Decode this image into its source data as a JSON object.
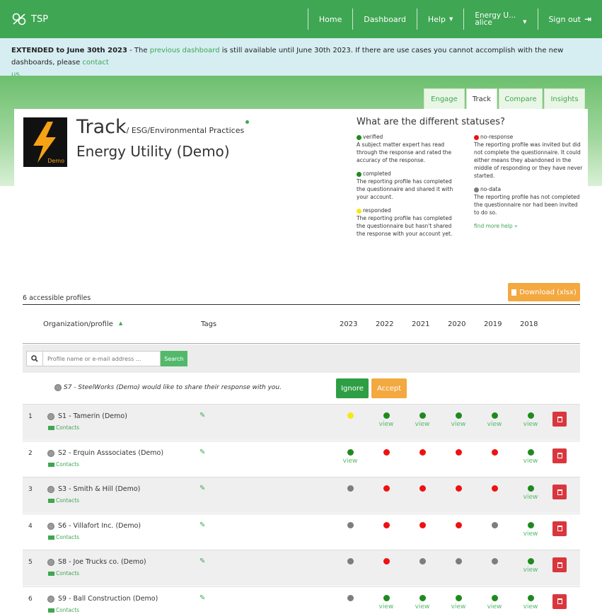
{
  "nav": {
    "brand": "TSP",
    "home": "Home",
    "dashboard": "Dashboard",
    "help": "Help",
    "account_line1": "Energy U...",
    "account_line2": "alice",
    "signout": "Sign out"
  },
  "alert": {
    "bold": "EXTENDED to June 30th 2023",
    "text1": " - The ",
    "link1": "previous dashboard",
    "text2": " is still available until June 30th 2023. If there are use cases you cannot accomplish with the new dashboards, please ",
    "link2": "contact",
    "link2b": "us",
    "text3": "."
  },
  "tabs": [
    "Engage",
    "Track",
    "Compare",
    "Insights"
  ],
  "active_tab": "Track",
  "header": {
    "logo_badge": "Demo",
    "title": "Track",
    "subtitle": "/ ESG/Environmental Practices",
    "org_name": "Energy Utility (Demo)"
  },
  "statuses": {
    "title": "What are the different statuses?",
    "items": [
      {
        "label": "verified",
        "color": "#1e8a1e",
        "description": "A subject matter expert has read through the response and rated the accuracy of the response."
      },
      {
        "label": "completed",
        "color": "#1e8a1e",
        "description": "The reporting profile has completed the questionnaire and shared it with your account."
      },
      {
        "label": "responded",
        "color": "#f7e815",
        "description": "The reporting profile has completed the questionnaire but hasn't shared the response with your account yet."
      },
      {
        "label": "no-response",
        "color": "#ee1111",
        "description": "The reporting profile was invited but did not complete the questionnaire. It could either means they abandoned in the middle of responding or they have never started."
      },
      {
        "label": "no-data",
        "color": "#7d7d7d",
        "description": "The reporting profile has not completed the questionnaire nor had been invited to do so."
      }
    ],
    "find_help": "find more help »"
  },
  "table": {
    "count_label": "6 accessible profiles",
    "download_label": "Download (xlsx)",
    "col_org": "Organization/profile",
    "col_tags": "Tags",
    "years": [
      "2023",
      "2022",
      "2021",
      "2020",
      "2019",
      "2018"
    ],
    "search_placeholder": "Profile name or e-mail address ...",
    "search_button": "Search",
    "share_request": "S7 - SteelWorks (Demo) would like to share their response with you.",
    "ignore_label": "Ignore",
    "accept_label": "Accept",
    "contacts_label": "Contacts",
    "view_label": "view",
    "rows": [
      {
        "num": "1",
        "name": "S1 - Tamerin (Demo)",
        "statuses": [
          "yellow",
          "green",
          "green",
          "green",
          "green",
          "green"
        ],
        "views": [
          false,
          true,
          true,
          true,
          true,
          true
        ]
      },
      {
        "num": "2",
        "name": "S2 - Erquin Asssociates (Demo)",
        "statuses": [
          "green",
          "red",
          "red",
          "red",
          "red",
          "green"
        ],
        "views": [
          true,
          false,
          false,
          false,
          false,
          true
        ]
      },
      {
        "num": "3",
        "name": "S3 - Smith & Hill (Demo)",
        "statuses": [
          "grey",
          "red",
          "red",
          "red",
          "red",
          "green"
        ],
        "views": [
          false,
          false,
          false,
          false,
          false,
          true
        ]
      },
      {
        "num": "4",
        "name": "S6 - Villafort Inc. (Demo)",
        "statuses": [
          "grey",
          "red",
          "red",
          "red",
          "grey",
          "green"
        ],
        "views": [
          false,
          false,
          false,
          false,
          false,
          true
        ]
      },
      {
        "num": "5",
        "name": "S8 - Joe Trucks co. (Demo)",
        "statuses": [
          "grey",
          "red",
          "grey",
          "grey",
          "grey",
          "green"
        ],
        "views": [
          false,
          false,
          false,
          false,
          false,
          true
        ]
      },
      {
        "num": "6",
        "name": "S9 - Ball Construction (Demo)",
        "statuses": [
          "grey",
          "green",
          "green",
          "green",
          "green",
          "green"
        ],
        "views": [
          false,
          true,
          true,
          true,
          true,
          true
        ]
      }
    ]
  }
}
